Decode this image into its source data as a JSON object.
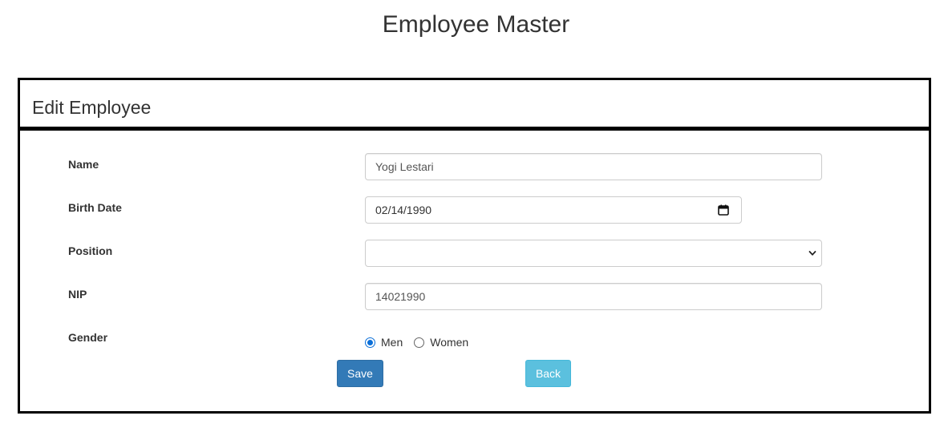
{
  "page": {
    "title": "Employee Master"
  },
  "card": {
    "title": "Edit Employee"
  },
  "form": {
    "name": {
      "label": "Name",
      "value": "Yogi Lestari"
    },
    "birth_date": {
      "label": "Birth Date",
      "value": "02/14/1990",
      "icon": "calendar-icon"
    },
    "position": {
      "label": "Position",
      "value": "",
      "icon": "chevron-down-icon"
    },
    "nip": {
      "label": "NIP",
      "value": "14021990"
    },
    "gender": {
      "label": "Gender",
      "options": [
        {
          "label": "Men",
          "checked": true
        },
        {
          "label": "Women",
          "checked": false
        }
      ]
    }
  },
  "buttons": {
    "save_label": "Save",
    "back_label": "Back"
  },
  "colors": {
    "primary": "#337ab7",
    "info": "#5bc0de",
    "radio_checked": "#0b6fd8"
  }
}
